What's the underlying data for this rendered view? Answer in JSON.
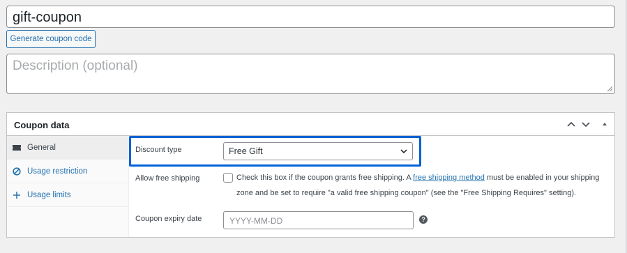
{
  "post": {
    "title_value": "gift-coupon",
    "generate_label": "Generate coupon code",
    "description_placeholder": "Description (optional)"
  },
  "panel": {
    "title": "Coupon data",
    "controls": [
      "chevron-up-icon",
      "chevron-down-icon",
      "triangle-up-icon"
    ]
  },
  "tabs": [
    {
      "label": "General",
      "icon": "ticket-icon",
      "active": true
    },
    {
      "label": "Usage restriction",
      "icon": "forbidden-icon",
      "active": false
    },
    {
      "label": "Usage limits",
      "icon": "plus-arrows-icon",
      "active": false
    }
  ],
  "fields": {
    "discount_type": {
      "label": "Discount type",
      "value": "Free Gift"
    },
    "free_shipping": {
      "label": "Allow free shipping",
      "checked": false,
      "text_before": "Check this box if the coupon grants free shipping. A ",
      "link_text": "free shipping method",
      "text_after": " must be enabled in your shipping zone and be set to require \"a valid free shipping coupon\" (see the \"Free Shipping Requires\" setting)."
    },
    "expiry": {
      "label": "Coupon expiry date",
      "placeholder": "YYYY-MM-DD"
    }
  },
  "colors": {
    "link": "#2271b1",
    "highlight_border": "#0062d4",
    "background": "#f0f0f1"
  }
}
